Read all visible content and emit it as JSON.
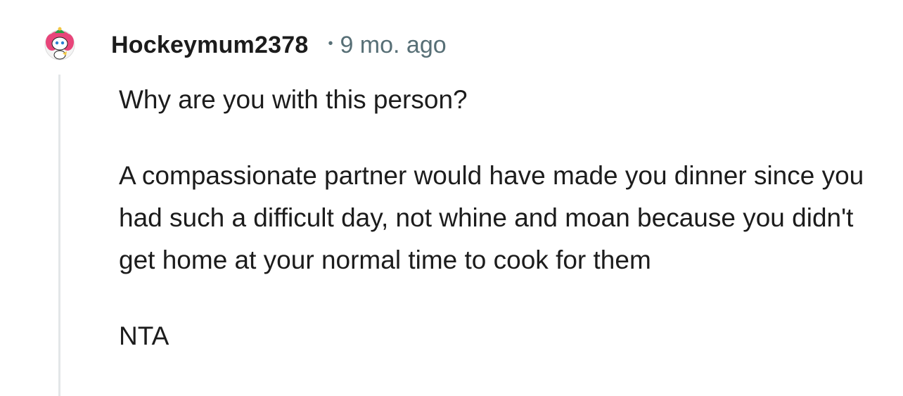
{
  "comment": {
    "author": "Hockeymum2378",
    "separator": "•",
    "timestamp": "9 mo. ago",
    "paragraphs": [
      "Why are you with this person?",
      "A compassionate partner would have made you dinner since you had such a difficult day, not whine and moan because you didn't get home at your normal time to cook for them",
      "NTA"
    ]
  },
  "avatar": {
    "icon": "snoo-avatar-icon",
    "colors": {
      "hair": "#e8457a",
      "hat": "#2a9d46",
      "face": "#ffffff"
    }
  },
  "colors": {
    "username": "#1c1c1c",
    "meta": "#576f76",
    "thread_line": "#e3e6e8"
  }
}
